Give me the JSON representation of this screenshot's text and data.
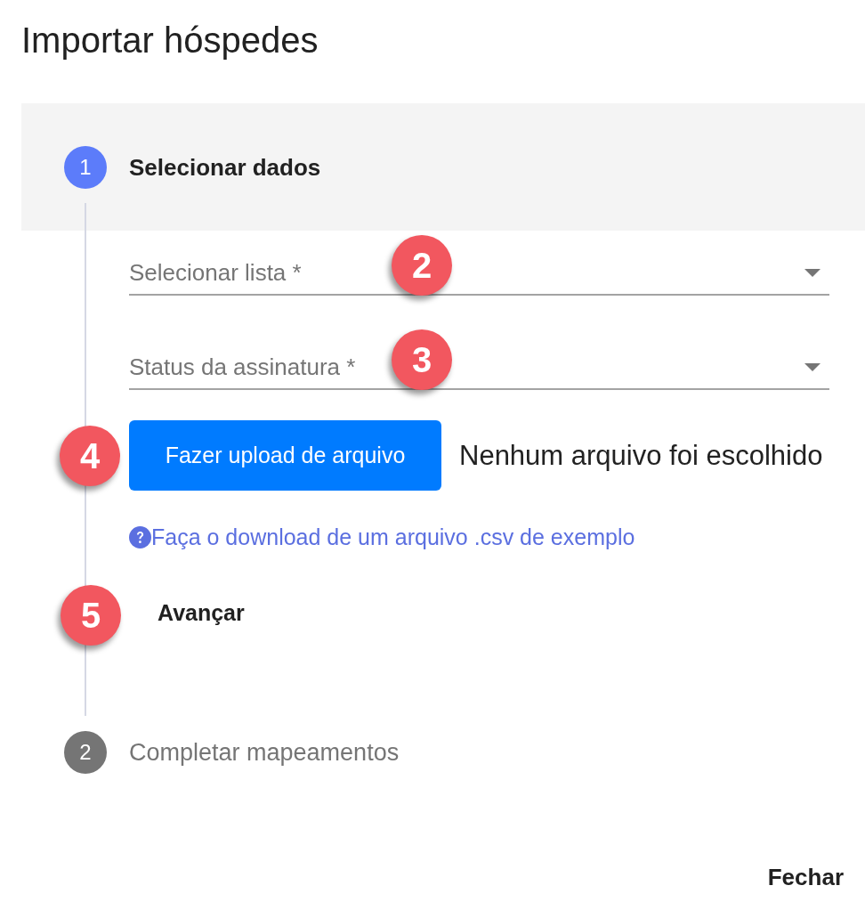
{
  "dialog": {
    "title": "Importar hóspedes"
  },
  "steps": [
    {
      "number": "1",
      "label": "Selecionar dados",
      "active": true,
      "fields": [
        {
          "placeholder": "Selecionar lista *",
          "callout": "2"
        },
        {
          "placeholder": "Status da assinatura *",
          "callout": "3"
        }
      ],
      "upload": {
        "button": "Fazer upload de arquivo",
        "callout": "4",
        "file_status": "Nenhum arquivo foi escolhido"
      },
      "help_link": "Faça o download de um arquivo .csv de exemplo",
      "next_button": {
        "label": "Avançar",
        "callout": "5"
      }
    },
    {
      "number": "2",
      "label": "Completar mapeamentos",
      "active": false
    }
  ],
  "footer": {
    "close_button": "Fechar"
  }
}
